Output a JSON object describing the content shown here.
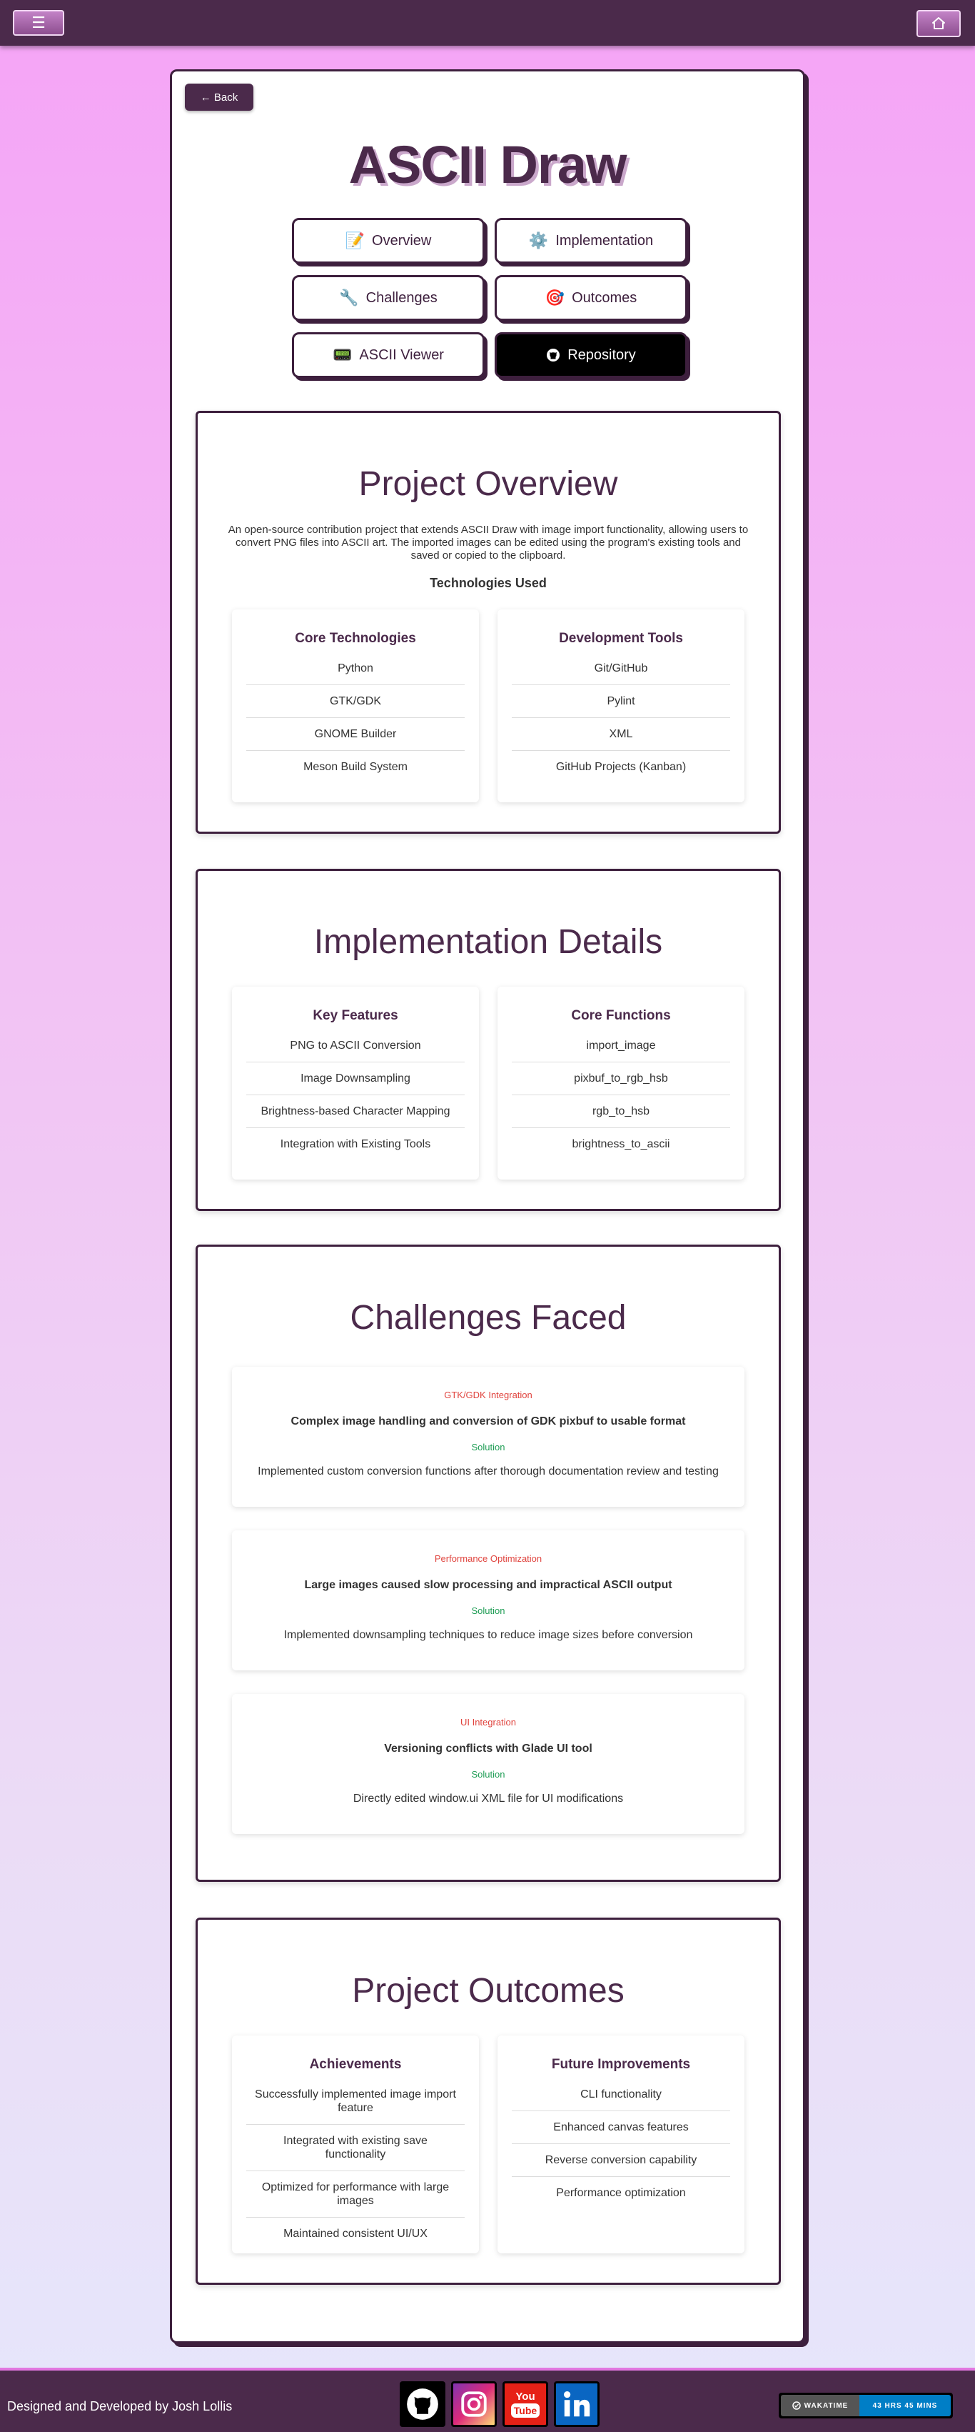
{
  "header": {
    "menu_icon": "hamburger-icon",
    "home_icon": "home-icon"
  },
  "back": {
    "label": "← Back"
  },
  "title": "ASCII Draw",
  "nav": [
    {
      "icon": "📝",
      "label": "Overview"
    },
    {
      "icon": "⚙️",
      "label": "Implementation"
    },
    {
      "icon": "🔧",
      "label": "Challenges"
    },
    {
      "icon": "🎯",
      "label": "Outcomes"
    },
    {
      "icon": "📟",
      "label": "ASCII Viewer"
    },
    {
      "icon": "github-icon",
      "label": "Repository"
    }
  ],
  "overview": {
    "heading": "Project Overview",
    "description": "An open-source contribution project that extends ASCII Draw with image import functionality, allowing users to convert PNG files into ASCII art. The imported images can be edited using the program's existing tools and saved or copied to the clipboard.",
    "tech_heading": "Technologies Used",
    "core": {
      "heading": "Core Technologies",
      "items": [
        "Python",
        "GTK/GDK",
        "GNOME Builder",
        "Meson Build System"
      ]
    },
    "dev": {
      "heading": "Development Tools",
      "items": [
        "Git/GitHub",
        "Pylint",
        "XML",
        "GitHub Projects (Kanban)"
      ]
    }
  },
  "implementation": {
    "heading": "Implementation Details",
    "features": {
      "heading": "Key Features",
      "items": [
        "PNG to ASCII Conversion",
        "Image Downsampling",
        "Brightness-based Character Mapping",
        "Integration with Existing Tools"
      ]
    },
    "functions": {
      "heading": "Core Functions",
      "items": [
        "import_image",
        "pixbuf_to_rgb_hsb",
        "rgb_to_hsb",
        "brightness_to_ascii"
      ]
    }
  },
  "challenges": {
    "heading": "Challenges Faced",
    "solution_label": "Solution",
    "items": [
      {
        "title": "GTK/GDK Integration",
        "problem": "Complex image handling and conversion of GDK pixbuf to usable format",
        "solution": "Implemented custom conversion functions after thorough documentation review and testing"
      },
      {
        "title": "Performance Optimization",
        "problem": "Large images caused slow processing and impractical ASCII output",
        "solution": "Implemented downsampling techniques to reduce image sizes before conversion"
      },
      {
        "title": "UI Integration",
        "problem": "Versioning conflicts with Glade UI tool",
        "solution": "Directly edited window.ui XML file for UI modifications"
      }
    ]
  },
  "outcomes": {
    "heading": "Project Outcomes",
    "achievements": {
      "heading": "Achievements",
      "items": [
        "Successfully implemented image import feature",
        "Integrated with existing save functionality",
        "Optimized for performance with large images",
        "Maintained consistent UI/UX"
      ]
    },
    "future": {
      "heading": "Future Improvements",
      "items": [
        "CLI functionality",
        "Enhanced canvas features",
        "Reverse conversion capability",
        "Performance optimization"
      ]
    }
  },
  "footer": {
    "credit": "Designed and Developed by Josh Lollis",
    "social": [
      "github-icon",
      "instagram-icon",
      "youtube-icon",
      "linkedin-icon"
    ],
    "wakatime_label": "WAKATIME",
    "wakatime_value": "43 HRS 45 MINS",
    "colors": {
      "bar": "#4b2a4b",
      "accent": "#e277e0",
      "solution": "#1f9d55",
      "challenge": "#e0443e"
    }
  }
}
